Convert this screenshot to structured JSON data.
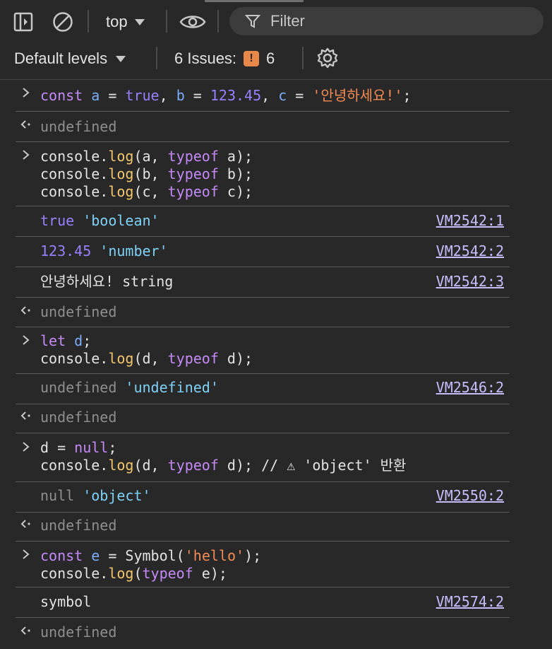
{
  "toolbar": {
    "context": "top",
    "filter_placeholder": "Filter",
    "levels": "Default levels",
    "issues_label": "6 Issues:",
    "issues_count": "6"
  },
  "console": {
    "in1": [
      "const",
      " ",
      "a",
      " = ",
      "true",
      ", ",
      "b",
      " = ",
      "123.45",
      ", ",
      "c",
      " = ",
      "'안녕하세요!'",
      ";"
    ],
    "undefined": "undefined",
    "in2_l1": [
      "console.",
      "log",
      "(a, ",
      "typeof",
      " a);"
    ],
    "in2_l2": [
      "console.",
      "log",
      "(b, ",
      "typeof",
      " b);"
    ],
    "in2_l3": [
      "console.",
      "log",
      "(c, ",
      "typeof",
      " c);"
    ],
    "out1": [
      "true",
      " ",
      "'boolean'"
    ],
    "out1_src": "VM2542:1",
    "out2": [
      "123.45",
      " ",
      "'number'"
    ],
    "out2_src": "VM2542:2",
    "out3": "안녕하세요! string",
    "out3_src": "VM2542:3",
    "in3_l1": [
      "let",
      " ",
      "d",
      ";"
    ],
    "in3_l2": [
      "console.",
      "log",
      "(d, ",
      "typeof",
      " d);"
    ],
    "out4": [
      "undefined",
      " ",
      "'undefined'"
    ],
    "out4_src": "VM2546:2",
    "in4_l1": [
      "d = ",
      "null",
      ";"
    ],
    "in4_l2": [
      "console.",
      "log",
      "(d, ",
      "typeof",
      " d); // ⚠ 'object' 반환"
    ],
    "out5": [
      "null",
      " ",
      "'object'"
    ],
    "out5_src": "VM2550:2",
    "in5_l1": [
      "const",
      " ",
      "e",
      " = Symbol(",
      "'hello'",
      ");"
    ],
    "in5_l2": [
      "console.",
      "log",
      "(",
      "typeof",
      " e);"
    ],
    "out6": "symbol",
    "out6_src": "VM2574:2"
  }
}
